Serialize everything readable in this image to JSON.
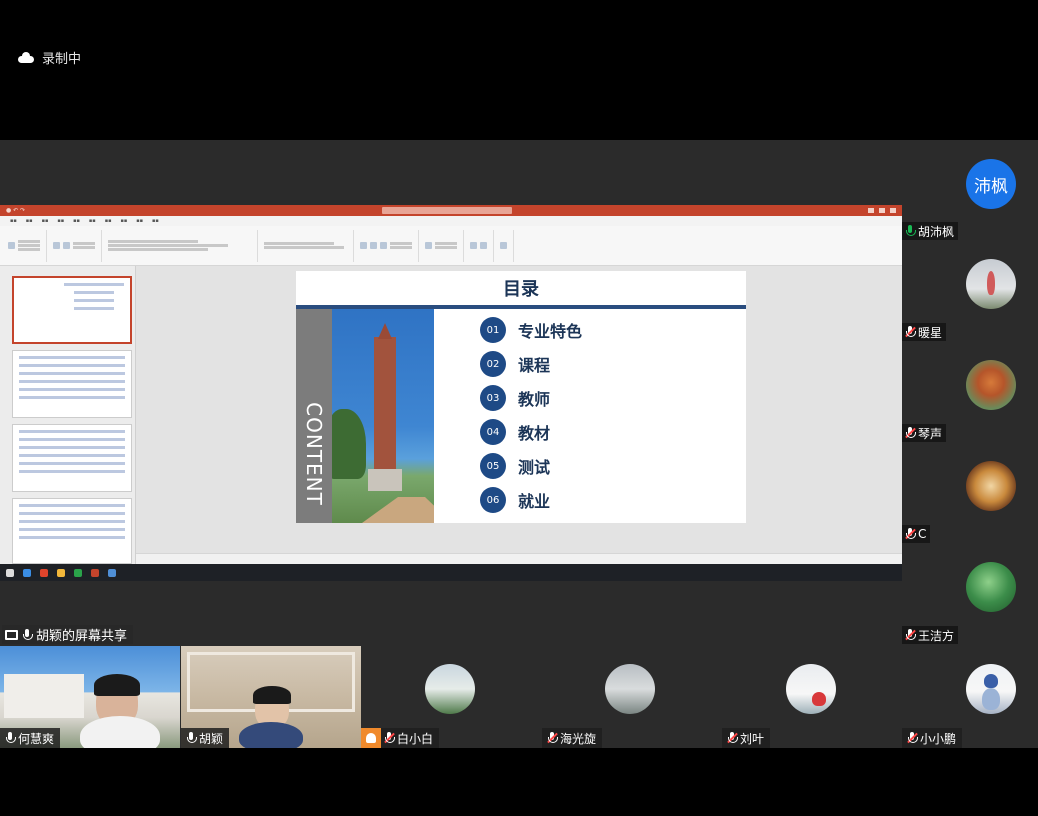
{
  "recording": {
    "label": "录制中",
    "icon": "cloud-icon"
  },
  "powerpoint": {
    "slide": {
      "title": "目录",
      "side_text": "CONTENT",
      "items": [
        {
          "num": "01",
          "label": "专业特色"
        },
        {
          "num": "02",
          "label": "课程"
        },
        {
          "num": "03",
          "label": "教师"
        },
        {
          "num": "04",
          "label": "教材"
        },
        {
          "num": "05",
          "label": "测试"
        },
        {
          "num": "06",
          "label": "就业"
        }
      ]
    },
    "colors": {
      "title_bar": "#c4442c",
      "accent": "#1e4a86"
    }
  },
  "share_label": {
    "text": "胡颖的屏幕共享"
  },
  "right_participants": [
    {
      "name": "胡沛枫",
      "avatar_text": "沛枫",
      "mic": "on"
    },
    {
      "name": "暖星",
      "mic": "off"
    },
    {
      "name": "琴声",
      "mic": "off"
    },
    {
      "name": "C",
      "mic": "off"
    },
    {
      "name": "王洁方",
      "mic": "off"
    }
  ],
  "bottom_participants": [
    {
      "name": "何慧爽",
      "mic": "plain"
    },
    {
      "name": "胡颖",
      "mic": "plain"
    },
    {
      "name": "白小白",
      "mic": "off"
    },
    {
      "name": "海光旋",
      "mic": "off"
    },
    {
      "name": "刘叶",
      "mic": "off"
    },
    {
      "name": "小小鹏",
      "mic": "off"
    }
  ],
  "colors": {
    "avatar_blue": "#1a74e8",
    "mic_on": "#19b955",
    "mic_off": "#ff4646"
  }
}
